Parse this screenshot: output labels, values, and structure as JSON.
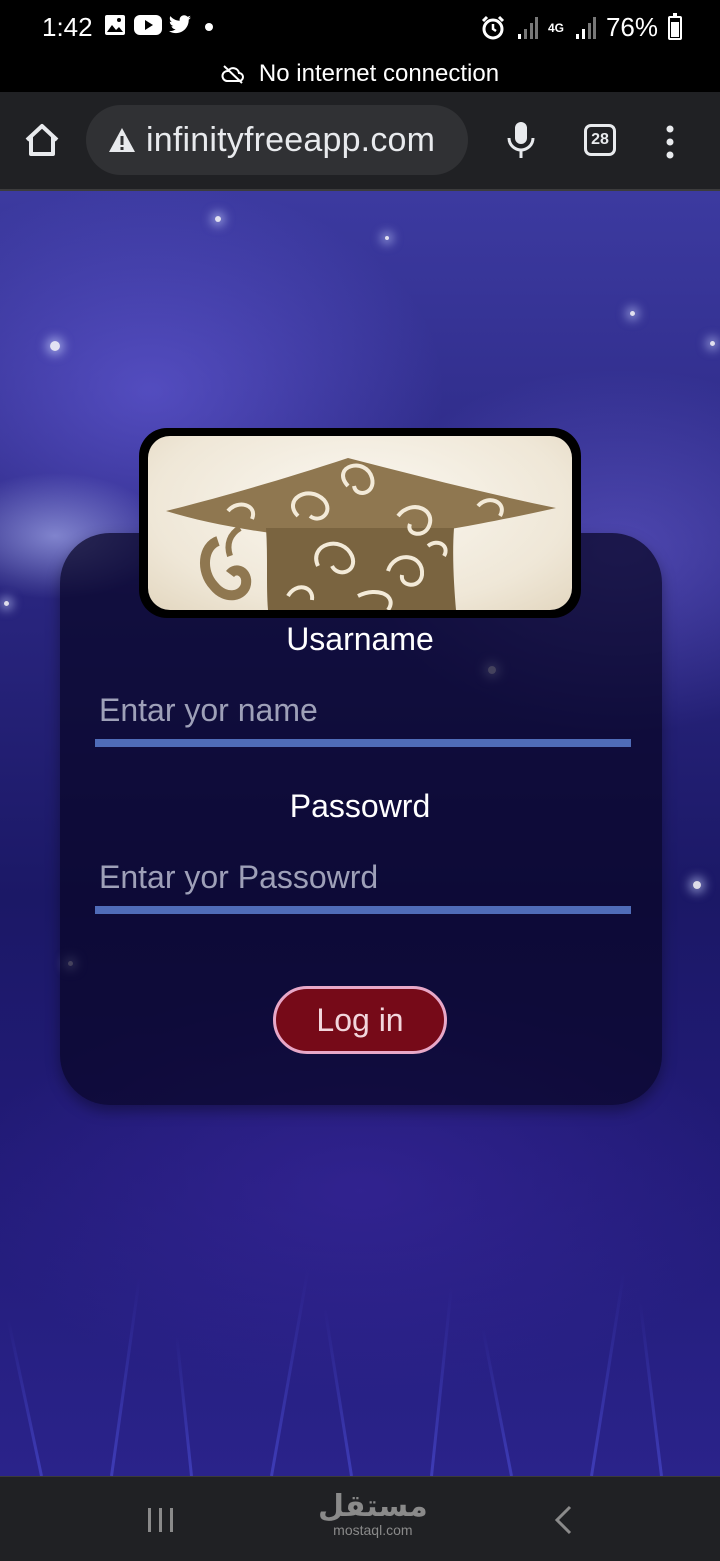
{
  "status_bar": {
    "time": "1:42",
    "network": "4G",
    "battery": "76%",
    "icons": [
      "gallery-icon",
      "youtube-icon",
      "twitter-icon",
      "notification-dot-icon",
      "alarm-icon",
      "signal-icon",
      "signal-4g-icon",
      "battery-icon"
    ]
  },
  "offline_banner": {
    "text": "No internet connection",
    "icon": "cloud-off-icon"
  },
  "browser": {
    "url": "infinityfreeapp.com",
    "security_icon": "warning-icon",
    "tab_count": "28",
    "icons": [
      "home-icon",
      "mic-icon",
      "tabs-icon",
      "more-vert-icon"
    ]
  },
  "login": {
    "logo_alt": "graduation-cap-logo",
    "username_label": "Usarname",
    "username_placeholder": "Entar yor name",
    "username_value": "",
    "password_label": "Passowrd",
    "password_placeholder": "Entar yor Passowrd",
    "password_value": "",
    "login_button": "Log in"
  },
  "nav_bar": {
    "watermark": "مستقل",
    "watermark_sub": "mostaql.com",
    "icons": [
      "recents-icon",
      "home-watermark",
      "back-icon"
    ]
  },
  "colors": {
    "card_background": "#08062b",
    "input_underline": "#4f6cb8",
    "button_background": "#760a18",
    "button_border": "#e8a8c8",
    "toolbar_background": "#202124"
  }
}
